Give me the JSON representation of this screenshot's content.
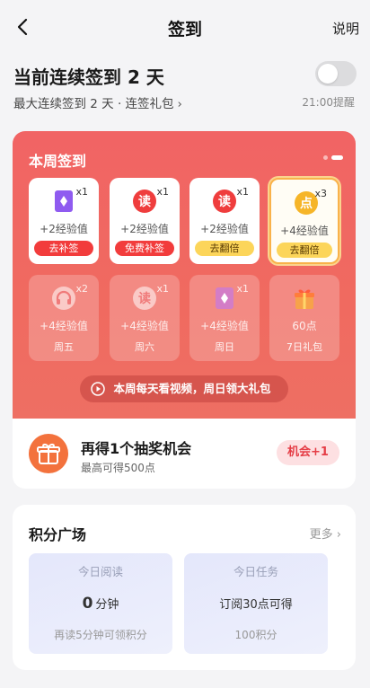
{
  "nav": {
    "title": "签到",
    "help": "说明"
  },
  "streak": {
    "title": "当前连续签到 2 天",
    "subtitle": "最大连续签到 2 天 · 连签礼包",
    "reminder": "21:00提醒",
    "reminder_on": false
  },
  "week": {
    "title": "本周签到",
    "days": [
      {
        "icon": "card-icon",
        "mult": "x1",
        "exp": "+2经验值",
        "action": "去补签"
      },
      {
        "icon": "read-icon",
        "mult": "x1",
        "exp": "+2经验值",
        "action": "免费补签"
      },
      {
        "icon": "read-icon",
        "mult": "x1",
        "exp": "+2经验值",
        "action": "去翻倍"
      },
      {
        "icon": "points-icon",
        "mult": "x3",
        "exp": "+4经验值",
        "action": "去翻倍"
      },
      {
        "icon": "headphones-icon",
        "mult": "x2",
        "exp": "+4经验值",
        "day": "周五"
      },
      {
        "icon": "read-icon",
        "mult": "x1",
        "exp": "+4经验值",
        "day": "周六"
      },
      {
        "icon": "card-icon",
        "mult": "x1",
        "exp": "+4经验值",
        "day": "周日"
      },
      {
        "icon": "gift-icon",
        "mult": "",
        "exp": "60点",
        "day": "7日礼包"
      }
    ],
    "video_banner": "本周每天看视频，周日领大礼包"
  },
  "lottery": {
    "title": "再得1个抽奖机会",
    "subtitle": "最高可得500点",
    "button": "机会+1"
  },
  "plaza": {
    "title": "积分广场",
    "more": "更多",
    "tasks": [
      {
        "head": "今日阅读",
        "value": "0",
        "unit": "分钟",
        "foot": "再读5分钟可领积分"
      },
      {
        "head": "今日任务",
        "text": "订阅30点可得",
        "foot": "100积分"
      }
    ]
  },
  "colors": {
    "accent": "#f16464",
    "highlight": "#f9b24a",
    "action_red": "#f23c3c",
    "action_yellow": "#fcd55a"
  }
}
